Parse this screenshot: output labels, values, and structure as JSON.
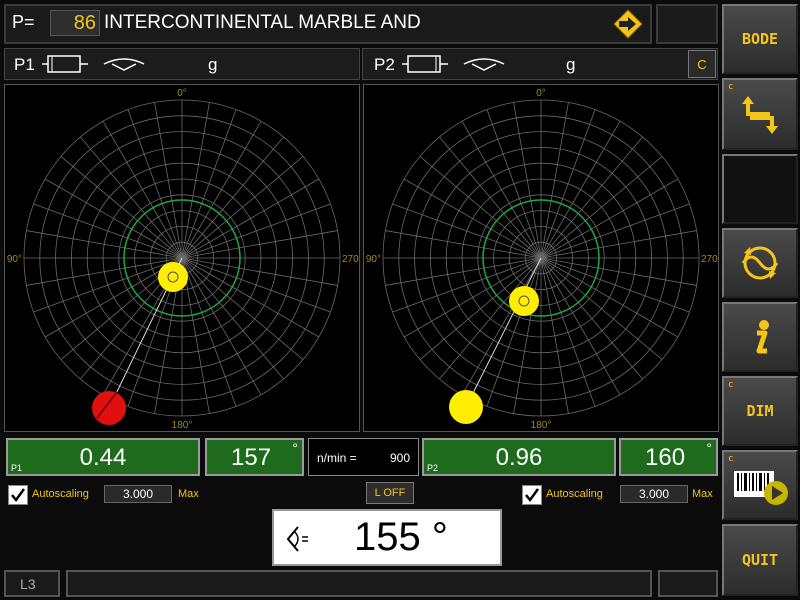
{
  "header": {
    "p_label": "P=",
    "p_value": "86",
    "title": "INTERCONTINENTAL MARBLE AND",
    "enter_icon": "arrow-right-diamond-icon"
  },
  "planes": [
    {
      "name": "P1",
      "unit": "g",
      "value": "0.44",
      "angle": "157",
      "tag": "P1",
      "autoscaling_label": "Autoscaling",
      "autoscaling_value": "3.000",
      "max_label": "Max",
      "autoscaling_checked": true,
      "angle_labels": {
        "top": "0°",
        "left": "90°",
        "right": "270°",
        "bottom": "180°"
      }
    },
    {
      "name": "P2",
      "unit": "g",
      "value": "0.96",
      "angle": "160",
      "tag": "P2",
      "c_label": "C",
      "autoscaling_label": "Autoscaling",
      "autoscaling_value": "3.000",
      "max_label": "Max",
      "autoscaling_checked": true,
      "angle_labels": {
        "top": "0°",
        "left": "90°",
        "right": "270°",
        "bottom": "180°"
      }
    }
  ],
  "speed": {
    "label": "n/min =",
    "value": "900"
  },
  "degree_symbol": "°",
  "l_off_label": "L OFF",
  "main_angle": {
    "value": "155 °",
    "icon": "phase-angle-icon"
  },
  "status": {
    "left": "L3"
  },
  "sidebar": {
    "bode": "BODE",
    "swap_c": "c",
    "swap_icon": "swap-arrows-icon",
    "orbit_icon": "orbit-wave-icon",
    "info_icon": "info-icon",
    "dim_c": "c",
    "dim": "DIM",
    "barcode_c": "c",
    "barcode_icon": "barcode-play-icon",
    "quit": "QUIT"
  },
  "colors": {
    "accent": "#f5c518",
    "value_bg": "#1e6b1e",
    "marker_red": "#e01010",
    "marker_yellow": "#ffee00",
    "ring_green": "#1faa3a"
  }
}
